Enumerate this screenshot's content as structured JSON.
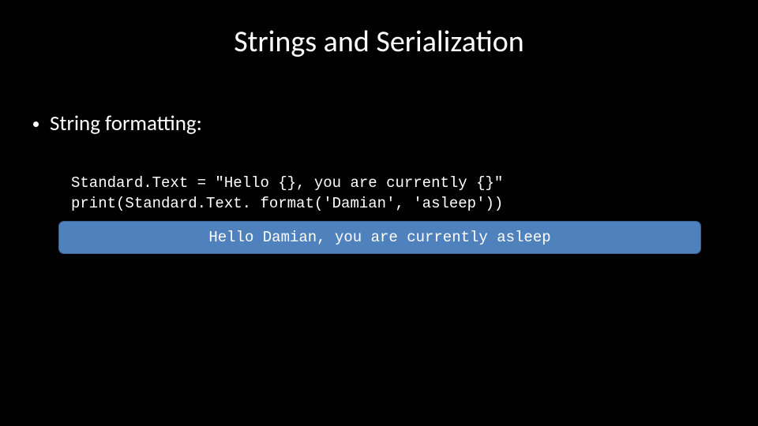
{
  "title": "Strings and Serialization",
  "bullet": "String formatting:",
  "code": {
    "line1": "Standard.Text = \"Hello {}, you are currently {}\"",
    "line2": "print(Standard.Text. format('Damian', 'asleep'))"
  },
  "output": "Hello Damian, you are currently asleep"
}
